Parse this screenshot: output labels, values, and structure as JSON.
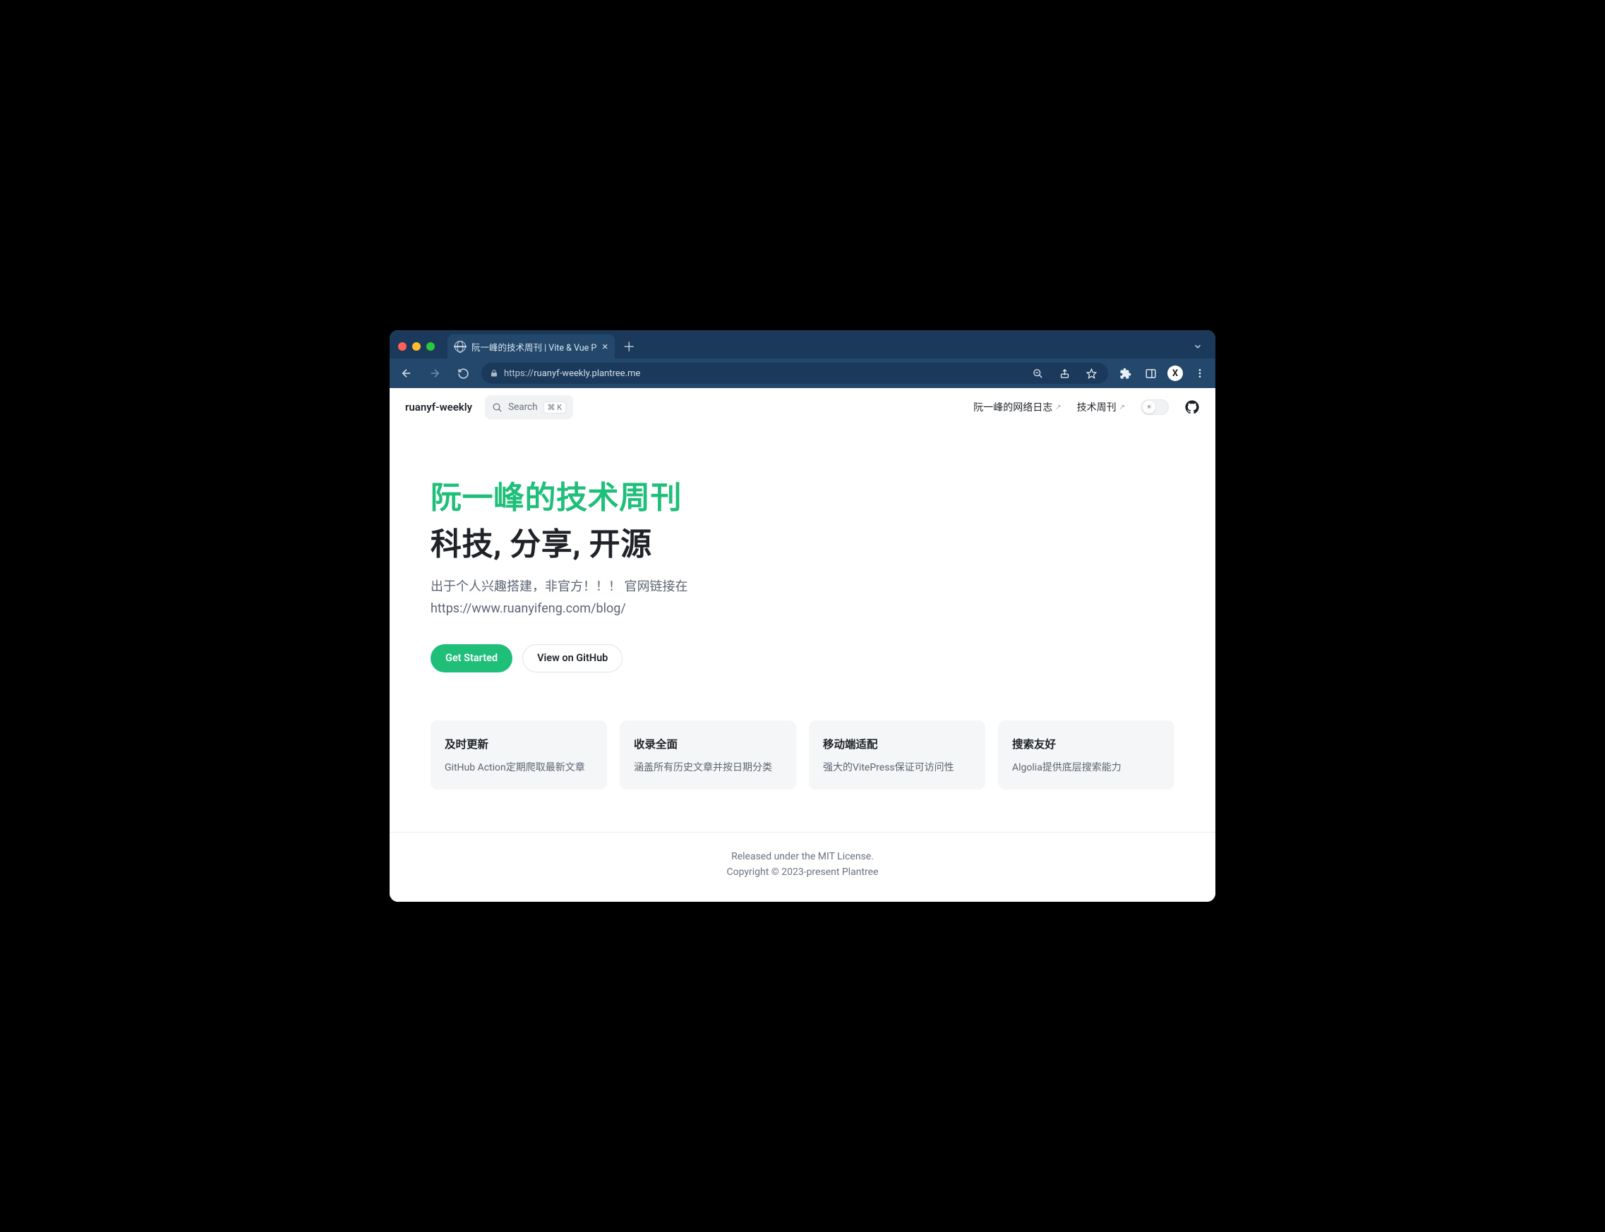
{
  "browser": {
    "tab_title": "阮一峰的技术周刊 | Vite & Vue P",
    "url_scheme": "https://",
    "url_host": "ruanyf-weekly.plantree.me",
    "avatar_letter": "X"
  },
  "header": {
    "brand": "ruanyf-weekly",
    "search_placeholder": "Search",
    "search_shortcut": "⌘ K",
    "nav": [
      {
        "label": "阮一峰的网络日志",
        "external": true
      },
      {
        "label": "技术周刊",
        "external": true
      }
    ]
  },
  "hero": {
    "title_green": "阮一峰的技术周刊",
    "title_dark": "科技, 分享, 开源",
    "desc_line1": "出于个人兴趣搭建，非官方！！！ 官网链接在",
    "desc_line2": "https://www.ruanyifeng.com/blog/",
    "primary_btn": "Get Started",
    "secondary_btn": "View on GitHub"
  },
  "features": [
    {
      "title": "及时更新",
      "desc": "GitHub Action定期爬取最新文章"
    },
    {
      "title": "收录全面",
      "desc": "涵盖所有历史文章并按日期分类"
    },
    {
      "title": "移动端适配",
      "desc": "强大的VitePress保证可访问性"
    },
    {
      "title": "搜索友好",
      "desc": "Algolia提供底层搜索能力"
    }
  ],
  "footer": {
    "line1": "Released under the MIT License.",
    "line2": "Copyright © 2023-present Plantree"
  }
}
